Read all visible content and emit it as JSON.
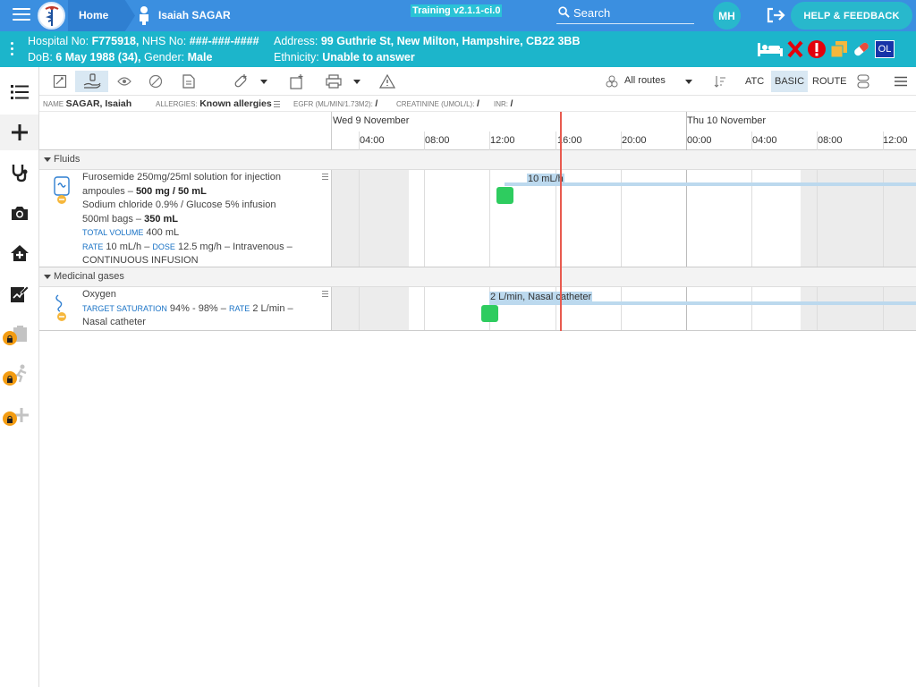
{
  "topbar": {
    "home_label": "Home",
    "patient_name": "Isaiah SAGAR",
    "training_label": "Training v2.1.1-ci.0",
    "search_label": "Search",
    "user_initials": "MH",
    "help_label": "HELP & FEEDBACK"
  },
  "banner": {
    "hospital_no_label": "Hospital No:",
    "hospital_no": "F775918,",
    "nhs_no_label": "NHS No:",
    "nhs_no": "###-###-####",
    "address_label": "Address:",
    "address": "99 Guthrie St, New Milton, Hampshire, CB22 3BB",
    "dob_label": "DoB:",
    "dob": "6 May 1988 (34),",
    "gender_label": "Gender:",
    "gender": "Male",
    "ethnicity_label": "Ethnicity:",
    "ethnicity": "Unable to answer",
    "ol_label": "OL"
  },
  "toolbar": {
    "routes_label": "All routes",
    "atc_label": "ATC",
    "basic_label": "BASIC",
    "route_label": "ROUTE"
  },
  "inforow": {
    "name_label": "NAME",
    "name": "SAGAR, Isaiah",
    "allergies_label": "ALLERGIES:",
    "allergies": "Known allergies",
    "egfr_label": "EGFR (ML/MIN/1.73M2):",
    "egfr": "/",
    "creatinine_label": "CREATININE (UMOL/L):",
    "creatinine": "/",
    "inr_label": "INR:",
    "inr": "/"
  },
  "timeline": {
    "day1": "Wed 9 November",
    "day2": "Thu 10 November",
    "hours": [
      "04:00",
      "08:00",
      "12:00",
      "16:00",
      "20:00",
      "00:00",
      "04:00",
      "08:00",
      "12:00"
    ]
  },
  "groups": {
    "fluids": "Fluids",
    "gases": "Medicinal gases"
  },
  "fluids_med": {
    "line1": "Furosemide 250mg/25ml solution for injection",
    "line2a": "ampoules – ",
    "line2b": "500 mg / 50 mL",
    "line3": "Sodium chloride 0.9% / Glucose 5% infusion",
    "line4a": "500ml bags – ",
    "line4b": "350 mL",
    "total_volume_label": "TOTAL VOLUME",
    "total_volume": "400 mL",
    "rate_label": "RATE",
    "rate": "10 mL/h –",
    "dose_label": "DOSE",
    "dose": "12.5 mg/h – Intravenous –",
    "line7": "CONTINUOUS INFUSION",
    "bar_label": "10 mL/h"
  },
  "gas_med": {
    "line1": "Oxygen",
    "target_label": "TARGET SATURATION",
    "target": "94% - 98% –",
    "rate_label": "RATE",
    "rate": "2 L/min –",
    "line3": "Nasal catheter",
    "bar_label": "2 L/min, Nasal catheter"
  }
}
